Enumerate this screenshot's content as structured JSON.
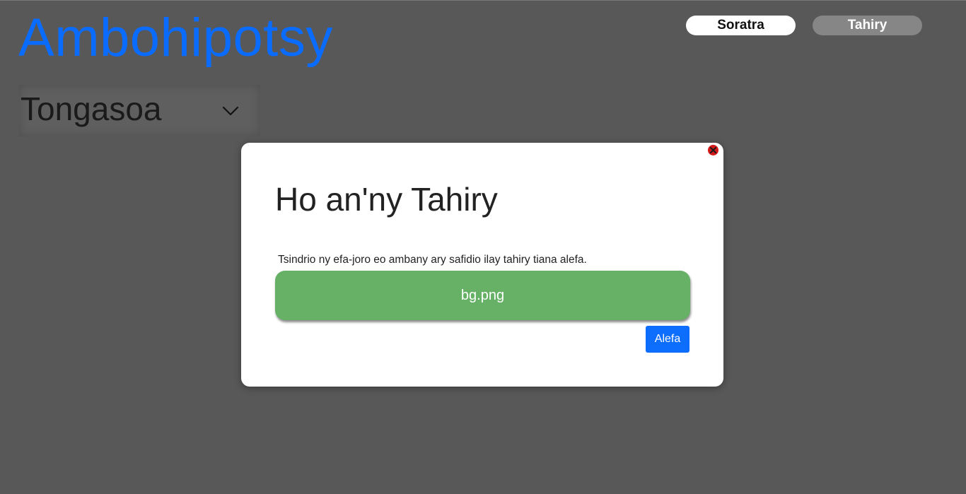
{
  "header": {
    "app_title": "Ambohipotsy",
    "nav": {
      "soratra_label": "Soratra",
      "tahiry_label": "Tahiry"
    }
  },
  "selector": {
    "selected_value": "Tongasoa",
    "icon": "chevron-down-icon"
  },
  "modal": {
    "title": "Ho an'ny Tahiry",
    "description": "Tsindrio ny efa-joro eo ambany ary safidio ilay tahiry tiana alefa.",
    "file_name": "bg.png",
    "submit_label": "Alefa",
    "close_icon": "close-icon"
  },
  "colors": {
    "background": "#585858",
    "title_blue": "#0a6cff",
    "file_green": "#66b166",
    "button_blue": "#0d6efd",
    "close_red": "#d31818"
  }
}
